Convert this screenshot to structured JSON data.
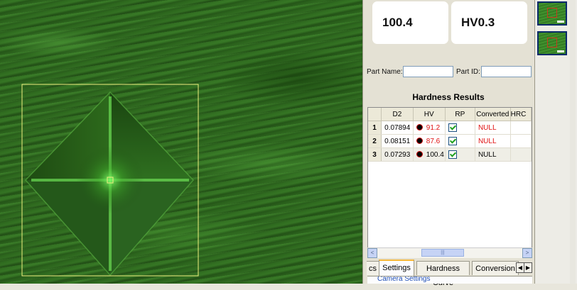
{
  "measurement": {
    "value": "100.4",
    "scale": "HV0.3"
  },
  "fields": {
    "part_name_label": "Part Name:",
    "part_name_value": "",
    "part_id_label": "Part ID:",
    "part_id_value": ""
  },
  "results": {
    "title": "Hardness Results",
    "columns": [
      "",
      "D2",
      "HV",
      "RP",
      "Converted",
      "HRC"
    ],
    "rows": [
      {
        "num": "1",
        "d2": "0.07894",
        "hv": "91.2",
        "rp": true,
        "converted": "NULL",
        "hv_red": true
      },
      {
        "num": "2",
        "d2": "0.08151",
        "hv": "87.6",
        "rp": true,
        "converted": "NULL",
        "hv_red": true
      },
      {
        "num": "3",
        "d2": "0.07293",
        "hv": "100.4",
        "rp": true,
        "converted": "NULL",
        "hv_red": false
      }
    ]
  },
  "scrollbar": {
    "left_arrow": "<",
    "right_arrow": ">",
    "thumb_grip": "|||"
  },
  "tabs": {
    "items": [
      "cs",
      "Settings",
      "Hardness Curve",
      "Conversion"
    ],
    "active": "Settings",
    "prev_arrow": "◀",
    "next_arrow": "▶"
  },
  "settings_panel": {
    "first_item": "Camera Settings"
  },
  "colors": {
    "accent_tab": "#f7b93a",
    "null_text": "#e01010",
    "measure_box": "#f0f080"
  },
  "icons": {
    "rp_check": "check-icon",
    "hv_marker": "point-marker-icon"
  }
}
